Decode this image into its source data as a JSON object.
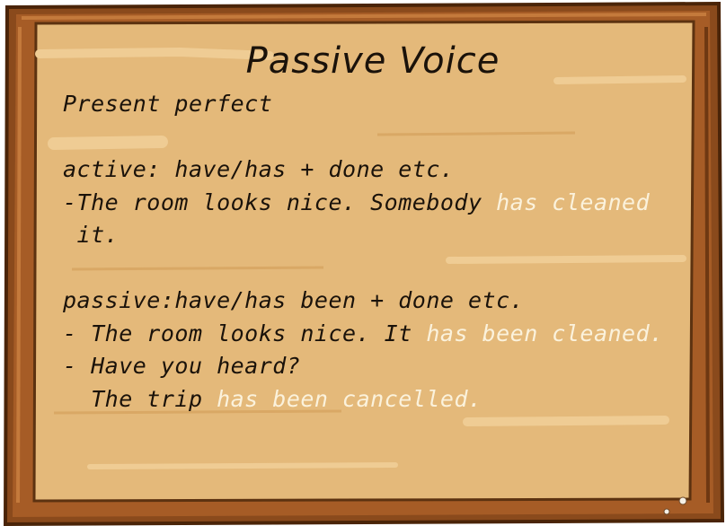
{
  "title": "Passive Voice",
  "subtitle": "Present perfect",
  "active": {
    "rule": "active: have/has + done etc.",
    "example_prefix": "-The room looks nice. Somebody ",
    "example_highlight": "has cleaned",
    "example_cont": " it."
  },
  "passive": {
    "rule": "passive:have/has been + done etc.",
    "ex1_prefix": "- The room looks nice. It ",
    "ex1_highlight": "has been cleaned.",
    "ex2_line1": "- Have you heard?",
    "ex2_prefix": "  The trip ",
    "ex2_highlight": "has been cancelled."
  },
  "colors": {
    "board": "#e2b778",
    "frame": "#8a4a1c",
    "highlight": "#fbf2dc"
  }
}
